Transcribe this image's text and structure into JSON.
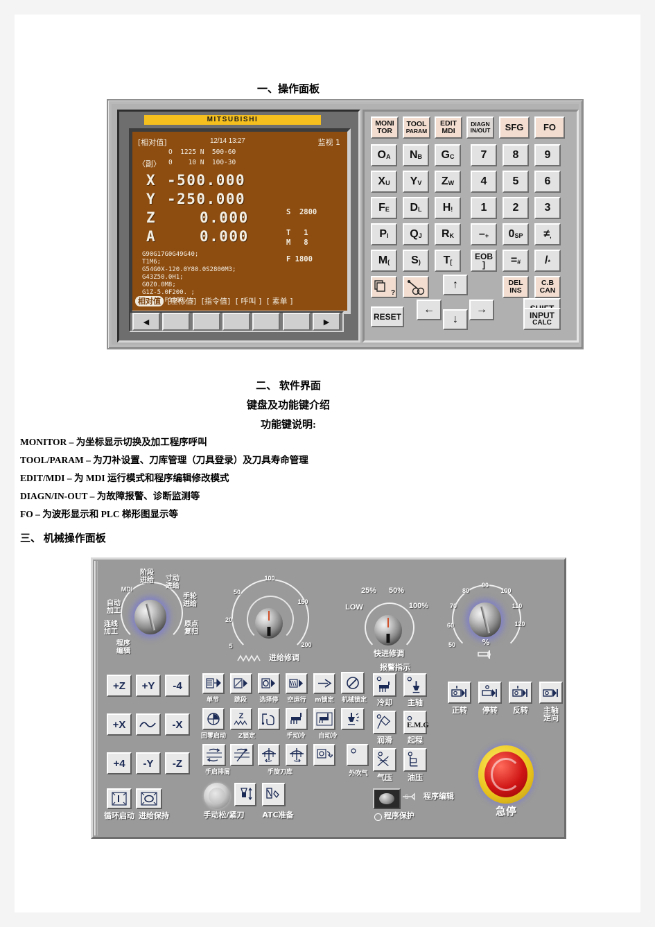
{
  "sections": {
    "s1_title": "一、操作面板",
    "s2_title": "二、 软件界面",
    "s2_sub1": "键盘及功能键介绍",
    "s2_sub2": "功能键说明:",
    "s3_title": "三、 机械操作面板"
  },
  "func_keys_desc": [
    "MONITOR   – 为坐标显示切换及加工程序呼叫",
    "TOOL/PARAM   – 为刀补设置、刀库管理（刀具登录）及刀具寿命管理",
    "EDIT/MDI  – 为 MDI 运行模式和程序编辑修改模式",
    "DIAGN/IN-OUT   – 为故障报警、诊断监测等",
    "FO –  为波形显示和 PLC  梯形图显示等"
  ],
  "cnc": {
    "brand": "MITSUBISHI",
    "screen": {
      "mode_label": "[相对值]",
      "datetime": "12/14 13:27",
      "monitor_label": "监视 1",
      "line_o": "O  1225 N  500-60",
      "sub_label": "〈副〉",
      "line_sub": "0    10 N  100-30",
      "axes": [
        {
          "name": "X",
          "value": "-500.000"
        },
        {
          "name": "Y",
          "value": "-250.000"
        },
        {
          "name": "Z",
          "value": "0.000"
        },
        {
          "name": "A",
          "value": "0.000"
        }
      ],
      "spindle_s": "S  2800",
      "tool_t": "T   1",
      "tool_m": "M   8",
      "feed_f": "F 1800",
      "program": [
        "G90G17G0G49G40;",
        "T1M6;",
        "G54G0X-120.0Y80.0S2800M3;",
        "G43Z50.0H1;",
        "G0Z0.0M8;",
        "G1Z-5.0F200. ;",
        "X-100.F1800. ;"
      ],
      "tabs": [
        {
          "label": "相对值",
          "selected": true
        },
        {
          "label": "座标值",
          "selected": false
        },
        {
          "label": "指令值",
          "selected": false
        },
        {
          "label": "呼叫",
          "selected": false
        },
        {
          "label": "素单",
          "selected": false
        }
      ]
    },
    "softkeys": [
      "◀",
      "",
      "",
      "",
      "",
      "",
      "▶"
    ],
    "function_keys": [
      {
        "top": "MONI",
        "bottom": "TOR",
        "accent": true
      },
      {
        "top": "TOOL",
        "bottom": "PARAM",
        "accent": true
      },
      {
        "top": "EDIT",
        "bottom": "MDI",
        "accent": true
      },
      {
        "top": "DIAGN",
        "bottom": "IN/OUT",
        "accent": true
      },
      {
        "top": "SFG",
        "bottom": "",
        "accent": true
      },
      {
        "top": "FO",
        "bottom": "",
        "accent": true
      }
    ],
    "alpha_keys": [
      {
        "main": "O",
        "sub": "A"
      },
      {
        "main": "N",
        "sub": "B"
      },
      {
        "main": "G",
        "sub": "C"
      },
      {
        "main": "X",
        "sub": "U"
      },
      {
        "main": "Y",
        "sub": "V"
      },
      {
        "main": "Z",
        "sub": "W"
      },
      {
        "main": "F",
        "sub": "E"
      },
      {
        "main": "D",
        "sub": "L"
      },
      {
        "main": "H",
        "sub": "!"
      },
      {
        "main": "P",
        "sub": "I"
      },
      {
        "main": "Q",
        "sub": "J"
      },
      {
        "main": "R",
        "sub": "K"
      },
      {
        "main": "M",
        "sub": "("
      },
      {
        "main": "S",
        "sub": ")"
      },
      {
        "main": "T",
        "sub": "["
      }
    ],
    "num_keys": [
      {
        "main": "7",
        "sub": ""
      },
      {
        "main": "8",
        "sub": ""
      },
      {
        "main": "9",
        "sub": ""
      },
      {
        "main": "4",
        "sub": ""
      },
      {
        "main": "5",
        "sub": ""
      },
      {
        "main": "6",
        "sub": ""
      },
      {
        "main": "1",
        "sub": ""
      },
      {
        "main": "2",
        "sub": ""
      },
      {
        "main": "3",
        "sub": ""
      },
      {
        "main": "–",
        "sub": "+"
      },
      {
        "main": "0",
        "sub": "SP"
      },
      {
        "main": "≠",
        "sub": ","
      },
      {
        "main": "EOB",
        "sub": "]"
      },
      {
        "main": "=",
        "sub": "#"
      },
      {
        "main": "/",
        "sub": "*"
      }
    ],
    "edit_keys": [
      {
        "top": "DEL",
        "bottom": "INS",
        "accent": true
      },
      {
        "top": "C.B",
        "bottom": "CAN",
        "accent": true
      }
    ],
    "symbol_keys": [
      {
        "name": "copy-question-key",
        "glyph": "?"
      },
      {
        "name": "link-key",
        "glyph": "∞"
      }
    ],
    "arrow_keys": {
      "up": "↑",
      "down": "↓",
      "left": "←",
      "right": "→"
    },
    "control_keys": {
      "reset": "RESET",
      "shift": "SHIFT",
      "input_top": "INPUT",
      "input_bottom": "CALC"
    }
  },
  "machine_panel": {
    "mode_dial": {
      "caption": "",
      "labels": [
        "自动\n加工",
        "MDI",
        "阶段\n进给",
        "寸动\n进给",
        "手轮\n进给",
        "原点\n复归",
        "连线\n加工",
        "程序\n编辑"
      ]
    },
    "feed_override": {
      "caption": "进给修调",
      "icon": "wave-icon",
      "ticks": [
        "5",
        "20",
        "50",
        "100",
        "150",
        "200"
      ]
    },
    "rapid_override": {
      "caption": "快进修调",
      "ticks": [
        "LOW",
        "25%",
        "50%",
        "100%"
      ]
    },
    "spindle_override": {
      "caption": "%",
      "sub_caption": "spindle-icon",
      "ticks": [
        "50",
        "60",
        "70",
        "80",
        "90",
        "100",
        "110",
        "120"
      ]
    },
    "alarm_header": "报警指示",
    "axis_buttons": [
      {
        "label": "+Z"
      },
      {
        "label": "+Y"
      },
      {
        "label": "-4"
      },
      {
        "label": "+X"
      },
      {
        "label": "wave-icon"
      },
      {
        "label": "-X"
      },
      {
        "label": "+4"
      },
      {
        "label": "-Y"
      },
      {
        "label": "-Z"
      }
    ],
    "cycle_buttons": [
      {
        "label": "循环启动",
        "icon": "cycle-start-icon"
      },
      {
        "label": "进给保持",
        "icon": "feed-hold-icon"
      }
    ],
    "row1_buttons": [
      {
        "label": "单节",
        "icon": "single-block-icon"
      },
      {
        "label": "跳段",
        "icon": "block-skip-icon"
      },
      {
        "label": "选择停",
        "icon": "optional-stop-icon"
      },
      {
        "label": "空运行",
        "icon": "dry-run-icon"
      },
      {
        "label": "m锁定",
        "icon": "m-lock-icon"
      },
      {
        "label": "机械锁定",
        "icon": "machine-lock-icon"
      }
    ],
    "row2_buttons": [
      {
        "label": "回零启动",
        "icon": "zero-return-icon"
      },
      {
        "label": "Z锁定",
        "icon": "z-lock-icon"
      },
      {
        "label": "",
        "icon": "manual-hand-icon"
      },
      {
        "label": "手动冷",
        "icon": "manual-coolant-icon"
      },
      {
        "label": "自动冷",
        "icon": "auto-coolant-icon"
      },
      {
        "label": "",
        "icon": "air-blow-icon"
      }
    ],
    "row3_buttons": [
      {
        "label": "手启排屑",
        "icon": "chip-conveyor-fwd-icon"
      },
      {
        "label": "",
        "icon": "chip-conveyor-rev-icon"
      },
      {
        "label": "手旋刀库",
        "icon": "magazine-cw-icon"
      },
      {
        "label": "",
        "icon": "magazine-ccw-icon"
      },
      {
        "label": "",
        "icon": "tool-change-icon"
      },
      {
        "label": "外吹气",
        "icon": "blow-icon"
      }
    ],
    "row4_buttons": [
      {
        "label": "手动松/紧刀",
        "icon": "tool-clamp-knob-icon"
      },
      {
        "label": "",
        "icon": "tool-unclamp-icon"
      },
      {
        "label": "ATC准备",
        "icon": "atc-ready-icon"
      }
    ],
    "alarm_lamps": [
      {
        "label": "冷却",
        "icon": "coolant-lamp-icon"
      },
      {
        "label": "主轴",
        "icon": "spindle-lamp-icon"
      },
      {
        "label": "润滑",
        "icon": "lubrication-lamp-icon"
      },
      {
        "label": "起程",
        "icon": "emg-lamp-icon",
        "text": "E.M.G"
      },
      {
        "label": "气压",
        "icon": "air-pressure-lamp-icon"
      },
      {
        "label": "油压",
        "icon": "oil-pressure-lamp-icon"
      }
    ],
    "program_edit": {
      "keyswitch_label": "程序编辑",
      "protect_label": "程序保护"
    },
    "spindle_buttons": [
      {
        "label": "正转",
        "icon": "spindle-cw-icon"
      },
      {
        "label": "停转",
        "icon": "spindle-stop-icon"
      },
      {
        "label": "反转",
        "icon": "spindle-ccw-icon"
      },
      {
        "label": "主轴\n定向",
        "icon": "spindle-orient-icon"
      }
    ],
    "estop_label": "急停"
  },
  "colors": {
    "brand_yellow": "#f5c01e",
    "crt_brown": "#8d4c10",
    "panel_gray": "#9a9a9a",
    "key_accent": "#f2ddd0",
    "estop_red": "#cf1515"
  }
}
